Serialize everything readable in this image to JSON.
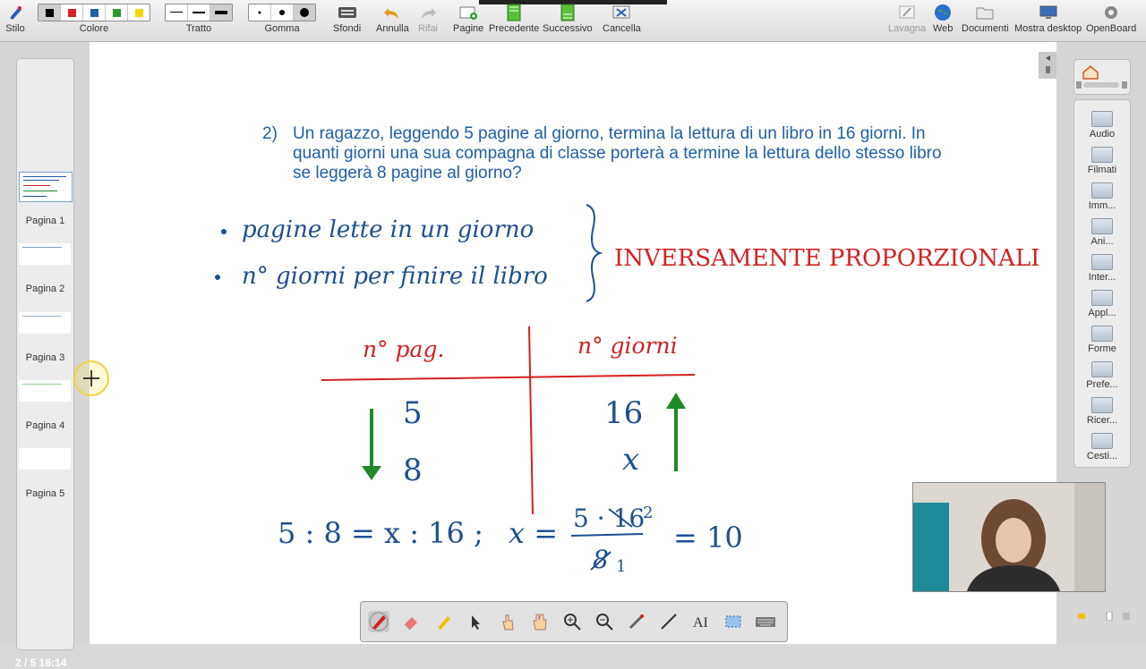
{
  "toolbar": {
    "stile": "Stilo",
    "colore": "Colore",
    "tratto": "Tratto",
    "gomma": "Gomma",
    "sfondi": "Sfondi",
    "annulla": "Annulla",
    "rifai": "Rifai",
    "pagine": "Pagine",
    "precedente": "Precedente",
    "successivo": "Successivo",
    "cancella": "Cancella",
    "lavagna": "Lavagna",
    "web": "Web",
    "documenti": "Documenti",
    "mostra_desktop": "Mostra desktop",
    "openboard": "OpenBoard",
    "colors": [
      "#000000",
      "#e02020",
      "#1f5ea8",
      "#2a9a2a",
      "#f2d800"
    ],
    "selected_color": "#000000"
  },
  "pages": {
    "items": [
      {
        "label": "Pagina 1"
      },
      {
        "label": "Pagina 2"
      },
      {
        "label": "Pagina 3"
      },
      {
        "label": "Pagina 4"
      },
      {
        "label": "Pagina 5"
      }
    ],
    "current_page": 2,
    "indicator": "2 / 5 16:14"
  },
  "library": {
    "items": [
      {
        "label": "Audio"
      },
      {
        "label": "Filmati"
      },
      {
        "label": "Imm..."
      },
      {
        "label": "Ani..."
      },
      {
        "label": "Inter..."
      },
      {
        "label": "Appl..."
      },
      {
        "label": "Forme"
      },
      {
        "label": "Prefe..."
      },
      {
        "label": "Ricer..."
      },
      {
        "label": "Cesti..."
      }
    ]
  },
  "board": {
    "problem_number": "2)",
    "problem_text": "Un ragazzo, leggendo 5 pagine al giorno, termina la lettura di un libro in 16 giorni. In quanti giorni una sua compagna di classe porterà a termine la lettura dello stesso libro se leggerà 8 pagine al giorno?",
    "handwriting": {
      "bullet_1": "pagine lette in un giorno",
      "bullet_2": "n° giorni per finire il libro",
      "relation": "INVERSAMENTE PROPORZIONALI",
      "col_1_header": "n° pag.",
      "col_2_header": "n° giorni",
      "row_1": [
        "5",
        "16"
      ],
      "row_2": [
        "8",
        "x"
      ],
      "equation": "5 : 8 = x : 16 ;",
      "solution_lhs": "x =",
      "numerator": "5 · 16",
      "numerator_note": "2",
      "denominator": "8",
      "denominator_note": "1",
      "result": "= 10"
    },
    "colors": {
      "printed": "#1f5ea8",
      "ink_blue": "#1f4f8f",
      "ink_red": "#d42020",
      "ink_green": "#1e8a2a"
    }
  }
}
